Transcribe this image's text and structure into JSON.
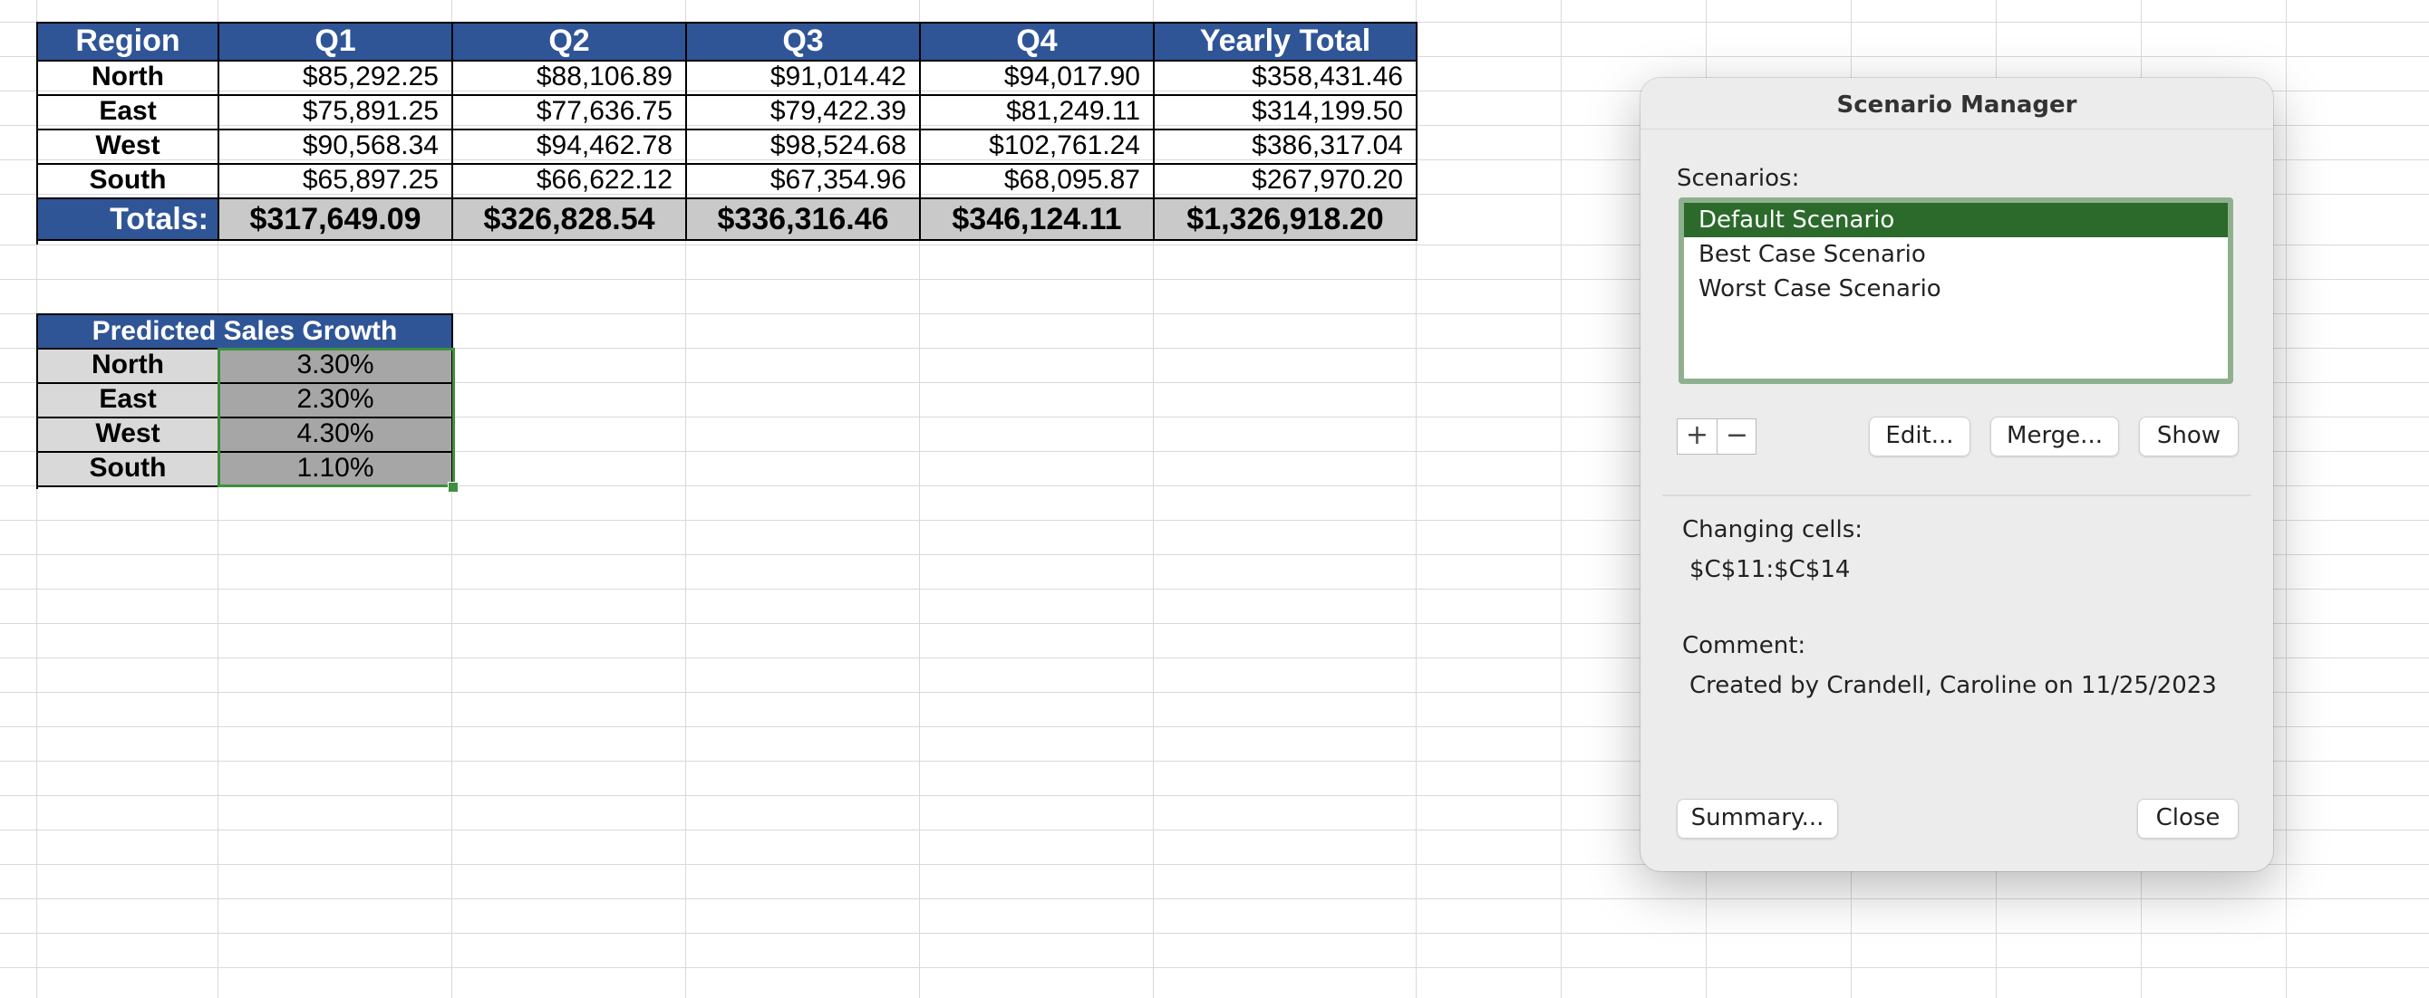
{
  "sales_table": {
    "headers": [
      "Region",
      "Q1",
      "Q2",
      "Q3",
      "Q4",
      "Yearly Total"
    ],
    "rows": [
      [
        "North",
        "$85,292.25",
        "$88,106.89",
        "$91,014.42",
        "$94,017.90",
        "$358,431.46"
      ],
      [
        "East",
        "$75,891.25",
        "$77,636.75",
        "$79,422.39",
        "$81,249.11",
        "$314,199.50"
      ],
      [
        "West",
        "$90,568.34",
        "$94,462.78",
        "$98,524.68",
        "$102,761.24",
        "$386,317.04"
      ],
      [
        "South",
        "$65,897.25",
        "$66,622.12",
        "$67,354.96",
        "$68,095.87",
        "$267,970.20"
      ]
    ],
    "totals_label": "Totals:",
    "totals": [
      "$317,649.09",
      "$326,828.54",
      "$336,316.46",
      "$346,124.11",
      "$1,326,918.20"
    ]
  },
  "growth_table": {
    "title": "Predicted Sales Growth",
    "rows": [
      [
        "North",
        "3.30%"
      ],
      [
        "East",
        "2.30%"
      ],
      [
        "West",
        "4.30%"
      ],
      [
        "South",
        "1.10%"
      ]
    ]
  },
  "dialog": {
    "title": "Scenario Manager",
    "scenarios_label": "Scenarios:",
    "scenarios": [
      "Default Scenario",
      "Best Case Scenario",
      "Worst Case Scenario"
    ],
    "selected_index": 0,
    "add_label": "+",
    "remove_label": "−",
    "edit_label": "Edit...",
    "merge_label": "Merge...",
    "show_label": "Show",
    "changing_cells_label": "Changing cells:",
    "changing_cells_value": "$C$11:$C$14",
    "comment_label": "Comment:",
    "comment_value": "Created by Crandell, Caroline on 11/25/2023",
    "summary_label": "Summary...",
    "close_label": "Close"
  },
  "colors": {
    "header_blue": "#2f5597",
    "selection_green": "#2b6a2b",
    "totals_gray": "#c9c9c9"
  }
}
